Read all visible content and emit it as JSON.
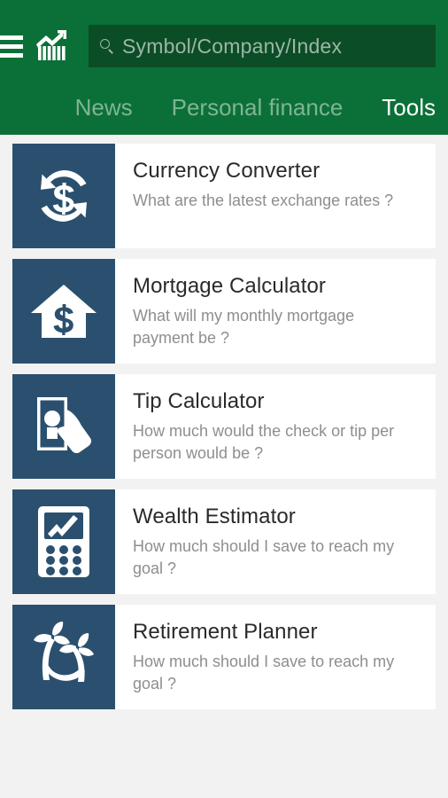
{
  "app": {
    "brand_green": "#0b7038",
    "search_field_green": "#0b4d27",
    "tile_blue": "#2b506f",
    "page_background": "#f2f2f2"
  },
  "header": {
    "menu_icon": "hamburger-menu-icon",
    "logo_icon": "bar-chart-trend-up-logo",
    "search": {
      "icon": "search-icon",
      "value": "",
      "placeholder": "Symbol/Company/Index"
    },
    "tabs": [
      {
        "label": "News",
        "active": false
      },
      {
        "label": "Personal finance",
        "active": false
      },
      {
        "label": "Tools",
        "active": true
      }
    ]
  },
  "tools": [
    {
      "title": "Currency Converter",
      "description": "What are the latest exchange rates ?",
      "icon": "currency-exchange-icon"
    },
    {
      "title": "Mortgage Calculator",
      "description": "What will my monthly mortgage payment be ?",
      "icon": "house-dollar-icon"
    },
    {
      "title": "Tip Calculator",
      "description": "How much would the check or tip per person would be ?",
      "icon": "hand-banknote-icon"
    },
    {
      "title": "Wealth Estimator",
      "description": "How much should I save to reach my goal ?",
      "icon": "calculator-chart-icon"
    },
    {
      "title": "Retirement Planner",
      "description": "How much should I save to reach my goal ?",
      "icon": "hammock-palm-trees-icon"
    }
  ]
}
